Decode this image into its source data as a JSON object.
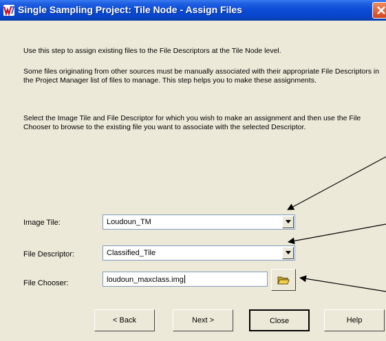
{
  "window": {
    "title": "Single Sampling Project: Tile Node - Assign Files"
  },
  "description": {
    "p1": "Use this step to assign existing files to the File Descriptors at the Tile Node level.",
    "p2": "Some files originating from other sources must be manually associated with their appropriate File Descriptors in the Project Manager list of files to manage. This step helps you to make these assignments.",
    "p3": "Select the Image Tile and File Descriptor for which you wish to make an assignment and then use the File Chooser to browse to the existing file you want to associate with the selected Descriptor."
  },
  "fields": {
    "image_tile": {
      "label": "Image Tile:",
      "value": "Loudoun_TM"
    },
    "file_descriptor": {
      "label": "File Descriptor:",
      "value": "Classified_Tile"
    },
    "file_chooser": {
      "label": "File Chooser:",
      "value": "loudoun_maxclass.img"
    }
  },
  "buttons": {
    "back": "< Back",
    "next": "Next >",
    "close": "Close",
    "help": "Help"
  },
  "icons": {
    "app": "app-icon",
    "close": "close-icon",
    "dropdown": "chevron-down-icon",
    "browse": "folder-icon"
  },
  "colors": {
    "titlebar": "#0a4bd6",
    "dialog_bg": "#ece9d8",
    "close_button": "#d4441c"
  }
}
